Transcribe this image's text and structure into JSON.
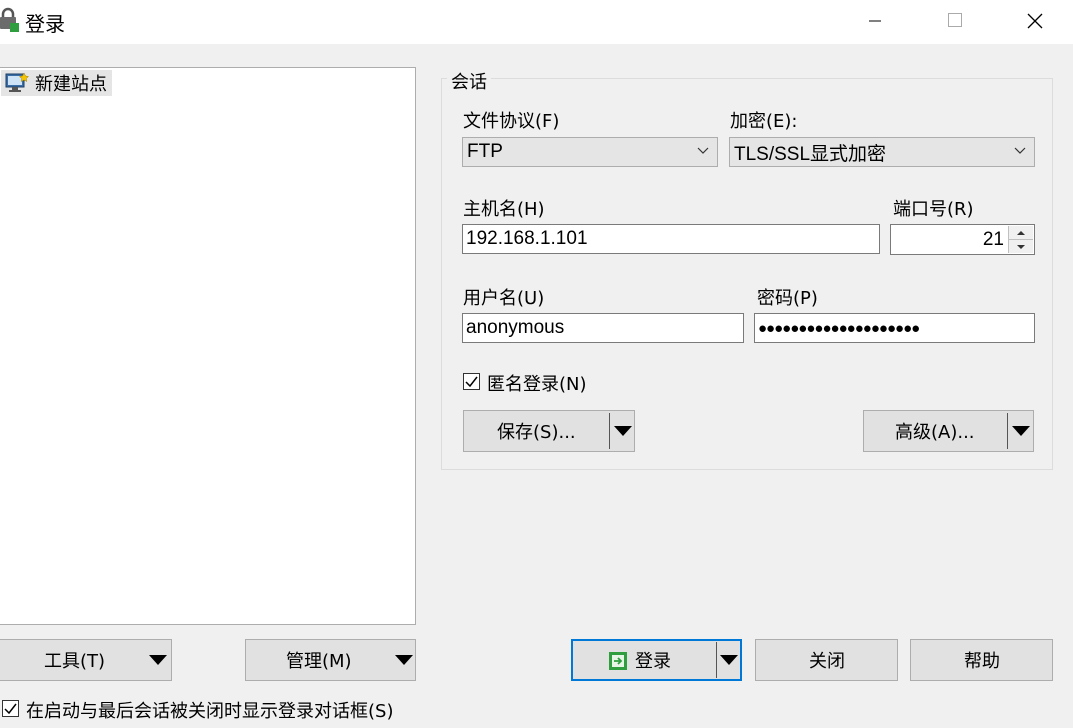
{
  "window": {
    "title": "登录",
    "icon": "lock-icon"
  },
  "sites": {
    "items": [
      {
        "label": "新建站点",
        "icon": "new-site-icon"
      }
    ]
  },
  "session": {
    "group_label": "会话",
    "protocol": {
      "label": "文件协议(F)",
      "value": "FTP"
    },
    "encryption": {
      "label": "加密(E):",
      "value": "TLS/SSL显式加密"
    },
    "host": {
      "label": "主机名(H)",
      "value": "192.168.1.101"
    },
    "port": {
      "label": "端口号(R)",
      "value": "21"
    },
    "username": {
      "label": "用户名(U)",
      "value": "anonymous"
    },
    "password": {
      "label": "密码(P)",
      "value": "●●●●●●●●●●●●●●●●●●●●"
    },
    "anonymous": {
      "label": "匿名登录(N)",
      "checked": true
    },
    "save_label": "保存(S)...",
    "advanced_label": "高级(A)..."
  },
  "bottom": {
    "tools_label": "工具(T)",
    "manage_label": "管理(M)",
    "login_label": "登录",
    "close_label": "关闭",
    "help_label": "帮助",
    "show_on_startup": {
      "label": "在启动与最后会话被关闭时显示登录对话框(S)",
      "checked": true
    }
  },
  "colors": {
    "accent": "#0078d7",
    "login_icon_green": "#2e9e3e"
  }
}
